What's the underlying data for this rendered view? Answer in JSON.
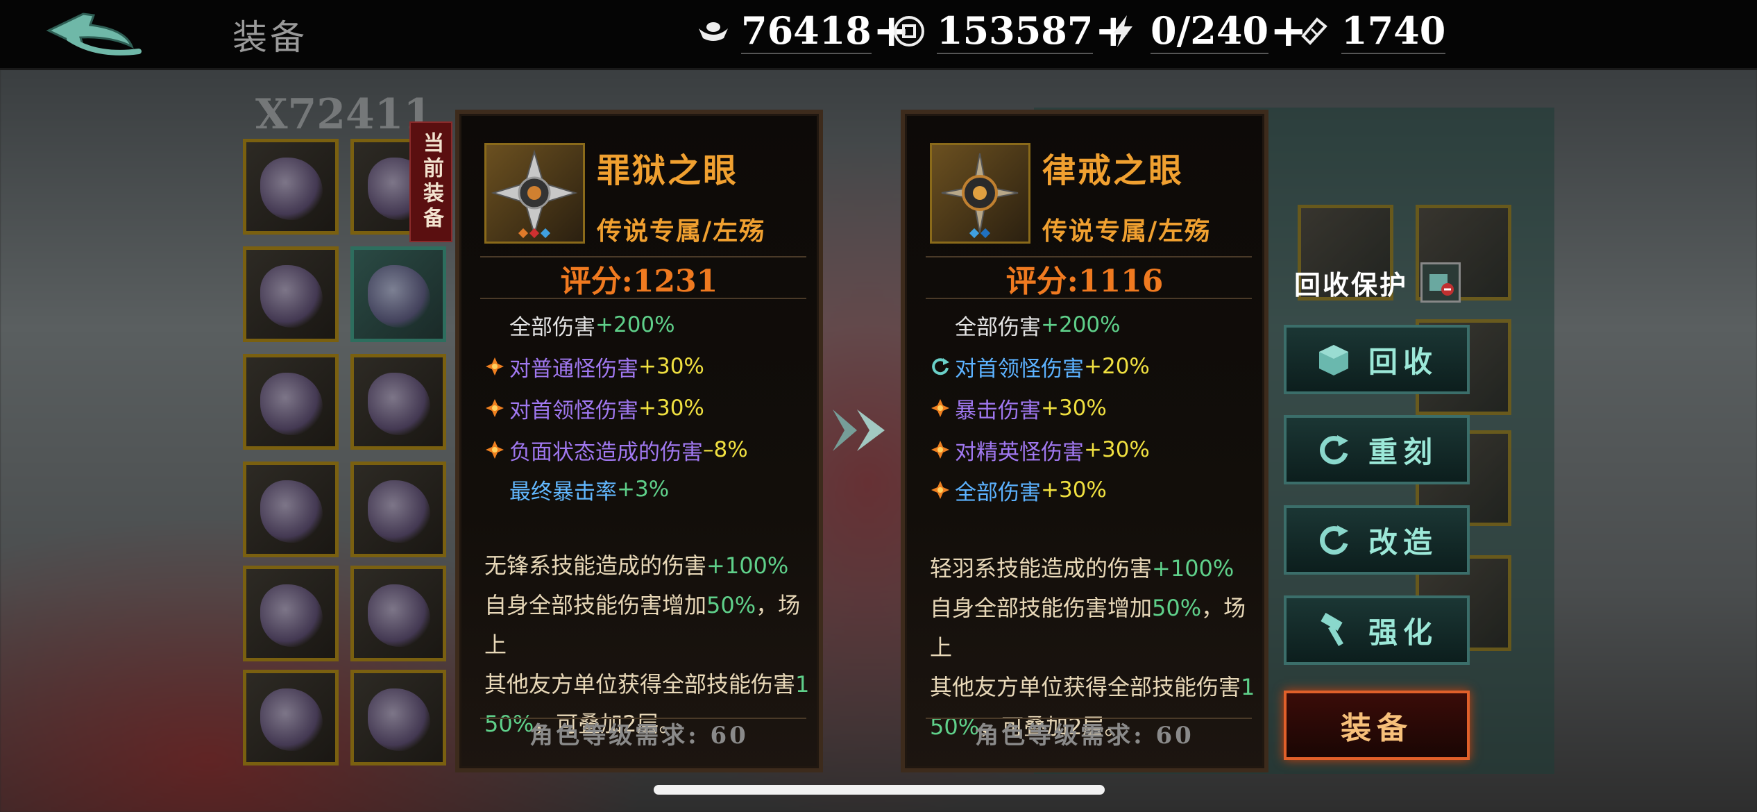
{
  "header": {
    "title": "装备",
    "resources": [
      {
        "icon": "silver-ingot-icon",
        "value": "76418",
        "has_plus": true
      },
      {
        "icon": "coin-icon",
        "value": "153587",
        "has_plus": true
      },
      {
        "icon": "lightning-icon",
        "value": "0/240",
        "has_plus": true
      },
      {
        "icon": "ticket-icon",
        "value": "1740",
        "has_plus": false
      }
    ],
    "plus_symbol": "+"
  },
  "inventory": {
    "label": "X72411",
    "current_tag": "当前装备"
  },
  "current_item": {
    "name": "罪狱之眼",
    "subtitle": "传说专属/左殇",
    "score_label": "评分:",
    "score": "1231",
    "stats": [
      {
        "marker": "none",
        "label": "全部伤害",
        "value": "+200%",
        "label_color": "#e5e5e5",
        "value_color": "#5fd08a"
      },
      {
        "marker": "orange-star-icon",
        "label": "对普通怪伤害",
        "value": "+30%",
        "label_color": "#a078f0",
        "value_color": "#f0e040"
      },
      {
        "marker": "orange-star-icon",
        "label": "对首领怪伤害",
        "value": "+30%",
        "label_color": "#a078f0",
        "value_color": "#f0e040"
      },
      {
        "marker": "orange-star-icon",
        "label": "负面状态造成的伤害",
        "value": "–8%",
        "label_color": "#a078f0",
        "value_color": "#f0e040"
      },
      {
        "marker": "none",
        "label": "最终暴击率",
        "value": "+3%",
        "label_color": "#62b8ff",
        "value_color": "#5fd08a"
      }
    ],
    "desc_line1_a": "无锋系技能造成的伤害",
    "desc_line1_b": "+100%",
    "desc_line2_a": "自身全部技能伤害增加",
    "desc_line2_b": "50%",
    "desc_line2_c": "，场上",
    "desc_line3_a": "其他友方单位获得全部技能伤害",
    "desc_line3_b": "1",
    "desc_line4_a": "50%",
    "desc_line4_b": "，可叠加2层。",
    "requirement": "角色等级需求: 60"
  },
  "compare_item": {
    "name": "律戒之眼",
    "subtitle": "传说专属/左殇",
    "score_label": "评分:",
    "score": "1116",
    "stats": [
      {
        "marker": "none",
        "label": "全部伤害",
        "value": "+200%",
        "label_color": "#e5e5e5",
        "value_color": "#5fd08a"
      },
      {
        "marker": "reforge-icon",
        "label": "对首领怪伤害",
        "value": "+20%",
        "label_color": "#5cb2ff",
        "value_color": "#f0e040"
      },
      {
        "marker": "orange-star-icon",
        "label": "暴击伤害",
        "value": "+30%",
        "label_color": "#a078f0",
        "value_color": "#f0e040"
      },
      {
        "marker": "orange-star-icon",
        "label": "对精英怪伤害",
        "value": "+30%",
        "label_color": "#a078f0",
        "value_color": "#f0e040"
      },
      {
        "marker": "orange-star-icon",
        "label": "全部伤害",
        "value": "+30%",
        "label_color": "#5cb2ff",
        "value_color": "#f0e040"
      }
    ],
    "desc_line1_a": "轻羽系技能造成的伤害",
    "desc_line1_b": "+100%",
    "desc_line2_a": "自身全部技能伤害增加",
    "desc_line2_b": "50%",
    "desc_line2_c": "，场上",
    "desc_line3_a": "其他友方单位获得全部技能伤害",
    "desc_line3_b": "1",
    "desc_line4_a": "50%",
    "desc_line4_b": "，可叠加2层。",
    "requirement": "角色等级需求: 60"
  },
  "actions": {
    "recycle_protection": "回收保护",
    "recycle": "回收",
    "reforge": "重刻",
    "modify": "改造",
    "enhance": "强化",
    "equip": "装备"
  }
}
